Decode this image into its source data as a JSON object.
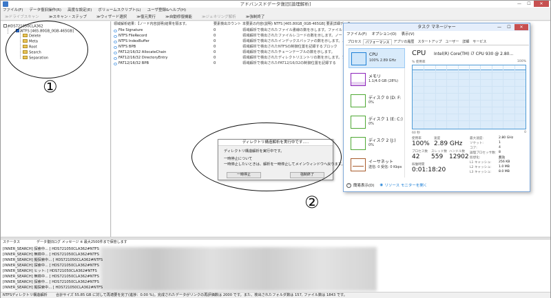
{
  "window": {
    "title": "アドバンスドデータ復旧[論理解析]",
    "min": "—",
    "max": "☐",
    "close": "✕"
  },
  "menu": [
    "ファイル(F)",
    "データ復旧操作(R)",
    "高度な設定(E)",
    "ボリュームスクリプト(L)",
    "ユーザ登録&ヘルプ(H)"
  ],
  "toolbar": {
    "items": [
      {
        "label": "≫ドライブスキャン",
        "disabled": true
      },
      {
        "label": "≫スキャン・ステップ",
        "disabled": false
      },
      {
        "label": "≫ウィザード選択",
        "disabled": false
      },
      {
        "label": "≫復元実行",
        "disabled": false
      },
      {
        "label": "≫自動修復機能",
        "disabled": false
      },
      {
        "label": "≫ジェネリング解析",
        "disabled": true
      },
      {
        "label": "≫強制終了",
        "disabled": false
      }
    ]
  },
  "tree": {
    "root": "HDS721050CLA362",
    "volume": "NTFS [465.80GB_0GB-465GB]",
    "folders": [
      "Delete",
      "Meta",
      "Root",
      "Search",
      "Separation"
    ]
  },
  "list": {
    "headers": {
      "name": "領域解析結果：【ノード内容説明(結果を隔ます。",
      "count": "要素検出カウント",
      "desc": "本要素の内容(説明) NTFS [465.80GB_0GB-465GB] 要素詳細データ"
    },
    "rows": [
      {
        "name": "File Signature",
        "count": "0",
        "desc": "領域解析で検出されたファイル書線の数を示します。ファイル"
      },
      {
        "name": "NTFS FileRecord",
        "count": "0",
        "desc": "領域解析で検出されたファイルレコードの数を示します。ノー"
      },
      {
        "name": "NTFS IndexBuffer",
        "count": "0",
        "desc": "領域解析で検出されたインデックスバッファの数を示します。ノ"
      },
      {
        "name": "NTFS BPB",
        "count": "0",
        "desc": "領域解析で検出されたNTFSの制御位置を記録するブロック"
      },
      {
        "name": "FAT12/16/32 AllocateChain",
        "count": "0",
        "desc": "領域解析で検出されたチェーンテーブルの数を示します。"
      },
      {
        "name": "FAT12/16/32 DirectoryEntry",
        "count": "0",
        "desc": "領域解析で検出されたディレクトリエントリの数を示します。フ"
      },
      {
        "name": "FAT12/16/32 BPB",
        "count": "0",
        "desc": "領域解析で検出されたFAT12/16/32の制御位置を記録する"
      }
    ]
  },
  "bottom": {
    "col1": "ステータス",
    "col2": "データ復旧ログ メッセージ ※ 最大2500件まで保管します",
    "logs": [
      "[INNER_SEARCH] 探索中... [ HDS721050CLA362#NTFS",
      "[INNER_SEARCH] 無検中... [ HDS721050CLA362#NTFS",
      "[INNER_SEARCH] 擬探索中... [ HDS721050CLA362#NTFS",
      "[INNER_SEARCH] 探索中... [ HDS721050CLA362#NTFS",
      "[INNER_SEARCH] ヒット: [ HDS721050CLA362#NTFS",
      "[INNER_SEARCH] 無検中... [ HDS721050CLA362#NTFS",
      "[INNER_SEARCH] 探索中... [ HDS721050CLA362#NTFS",
      "[INNER_SEARCH] 擬探索中... [ HDS721050CLA362#NTFS"
    ]
  },
  "statusbar": {
    "left": "NTFSディレクトリ構造解析",
    "right": "合計サイズ 55.85 GB に対して再適要を完了(進捗：0.00 %)。完成されたデータがリンクの再評価数は 2000 です。また、検出されたフォルダ数は 157, ファイル数は 1843 です。"
  },
  "dialog": {
    "title": "ディレクトリ構造解析を実行中です.....",
    "line1": "ディレクトリ構造解析を実行中です。",
    "line2": "一時停止について",
    "line3": "一時停止したいときは、解析を一時停止してメインウィンドウへ戻ります。",
    "btn_pause": "一時停止",
    "btn_stop": "強制終了"
  },
  "annotations": {
    "one": "①",
    "two": "②"
  },
  "taskmgr": {
    "title": "タスク マネージャー",
    "menu": [
      "ファイル(F)",
      "オプション(O)",
      "表示(V)"
    ],
    "tabs": [
      "プロセス",
      "パフォーマンス",
      "アプリの履歴",
      "スタートアップ",
      "ユーザー",
      "詳細",
      "サービス"
    ],
    "active_tab": "パフォーマンス",
    "side": [
      {
        "name": "CPU",
        "value": "100% 2.89 GHz",
        "color": "#1c7fd6"
      },
      {
        "name": "メモリ",
        "value": "1.1/4.0 GB (28%)",
        "color": "#8b21b9"
      },
      {
        "name": "ディスク 0 (D: F:",
        "value": "0%",
        "color": "#4da832"
      },
      {
        "name": "ディスク 1 (E: C:)",
        "value": "0%",
        "color": "#4da832"
      },
      {
        "name": "ディスク 2 (J:)",
        "value": "0%",
        "color": "#4da832"
      },
      {
        "name": "イーサネット",
        "value": "送信: 0 受信: 0 Kbps",
        "color": "#a75a2a"
      }
    ],
    "cpu_title": "CPU",
    "cpu_model": "Intel(R) Core(TM) i7 CPU 930 @ 2.80...",
    "graph_label": "% 使用率",
    "graph_max": "100%",
    "graph_time": "60 秒",
    "graph_zero": "0",
    "stats": {
      "util_lbl": "使用率",
      "util": "100%",
      "speed_lbl": "速度",
      "speed": "2.89 GHz",
      "proc_lbl": "プロセス数",
      "proc": "42",
      "thread_lbl": "スレッド数",
      "thread": "559",
      "handle_lbl": "ハンドル数",
      "handle": "12902",
      "uptime_lbl": "稼働時間",
      "uptime": "0:01:18:20"
    },
    "right_stats": [
      {
        "label": "最大速度:",
        "value": "2.80 GHz"
      },
      {
        "label": "ソケット:",
        "value": "1"
      },
      {
        "label": "コア:",
        "value": "4"
      },
      {
        "label": "論理プロセッサ数:",
        "value": "8"
      },
      {
        "label": "仮想化:",
        "value": "無効"
      },
      {
        "label": "L1 キャッシュ:",
        "value": "256 KB"
      },
      {
        "label": "L2 キャッシュ:",
        "value": "1.0 MB"
      },
      {
        "label": "L3 キャッシュ:",
        "value": "8.0 MB"
      }
    ],
    "footer_brief": "簡易表示(D)",
    "footer_link": "リソース モニターを開く"
  }
}
